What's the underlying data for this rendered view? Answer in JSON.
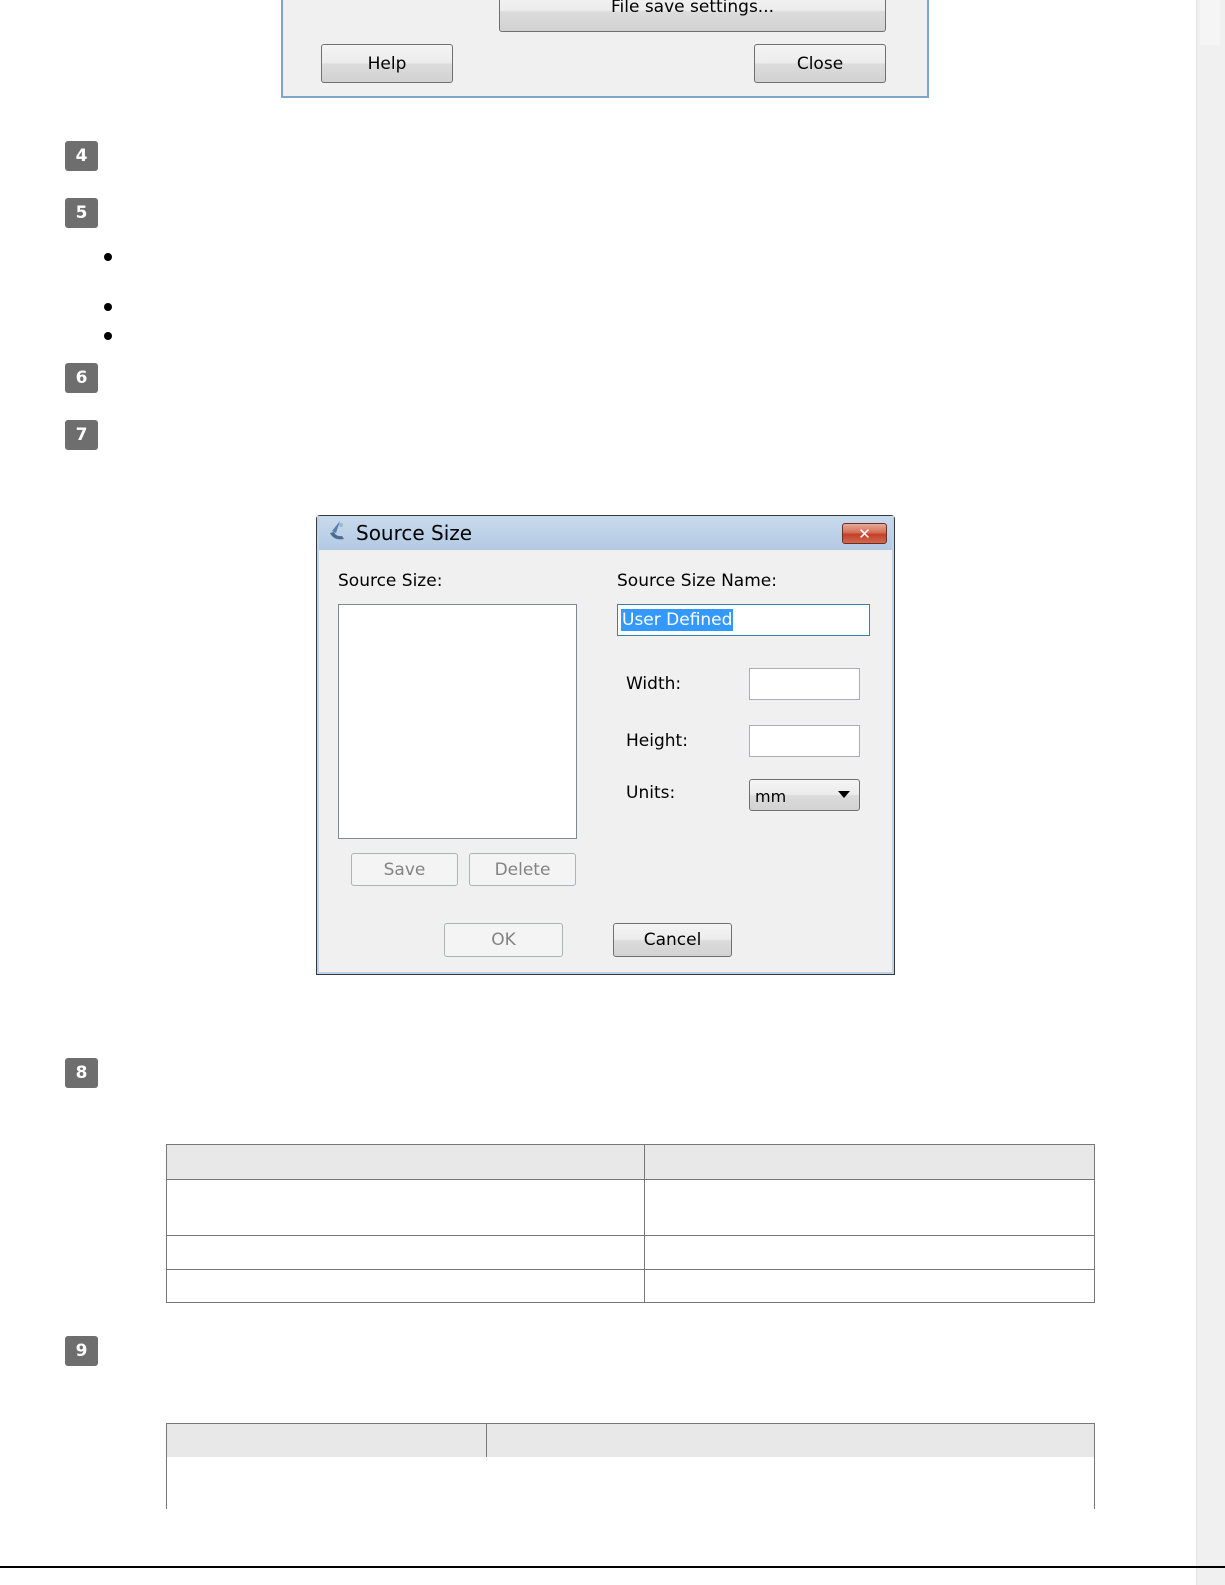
{
  "top_dialog": {
    "file_save_button": "File save settings...",
    "help_button": "Help",
    "close_button": "Close"
  },
  "steps": [
    "4",
    "5",
    "6",
    "7",
    "8",
    "9"
  ],
  "source_size_dialog": {
    "title": "Source Size",
    "close_glyph": "✕",
    "source_size_label": "Source Size:",
    "source_size_name_label": "Source Size Name:",
    "source_size_name_value": "User Defined",
    "width_label": "Width:",
    "height_label": "Height:",
    "units_label": "Units:",
    "units_value": "mm",
    "save_button": "Save",
    "delete_button": "Delete",
    "ok_button": "OK",
    "cancel_button": "Cancel"
  },
  "colors": {
    "titlebar": "#b3cae3",
    "selection": "#3399ff",
    "badge": "#6e6e6e"
  }
}
